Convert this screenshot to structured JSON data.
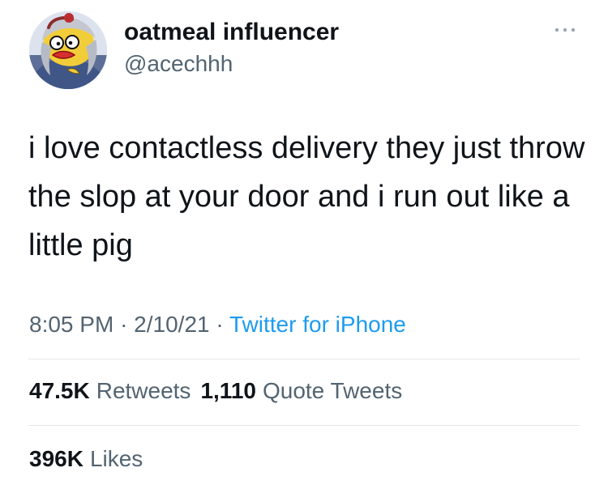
{
  "author": {
    "display_name": "oatmeal influencer",
    "handle": "@acechhh",
    "avatar_icon": "cartoon-avatar-icon"
  },
  "tweet": {
    "text": "i love contactless delivery they just throw the slop at your door and i run out like a little pig",
    "time": "8:05 PM",
    "date": "2/10/21",
    "separator": "·",
    "source": "Twitter for iPhone"
  },
  "stats": {
    "retweets": {
      "count": "47.5K",
      "label": "Retweets"
    },
    "quote_tweets": {
      "count": "1,110",
      "label": "Quote Tweets"
    },
    "likes": {
      "count": "396K",
      "label": "Likes"
    }
  },
  "actions": {
    "more_icon": "more-options-icon"
  },
  "colors": {
    "primary_text": "#0f1419",
    "secondary_text": "#536471",
    "link": "#1d9bf0",
    "divider": "#e1e6ea",
    "background": "#ffffff"
  }
}
